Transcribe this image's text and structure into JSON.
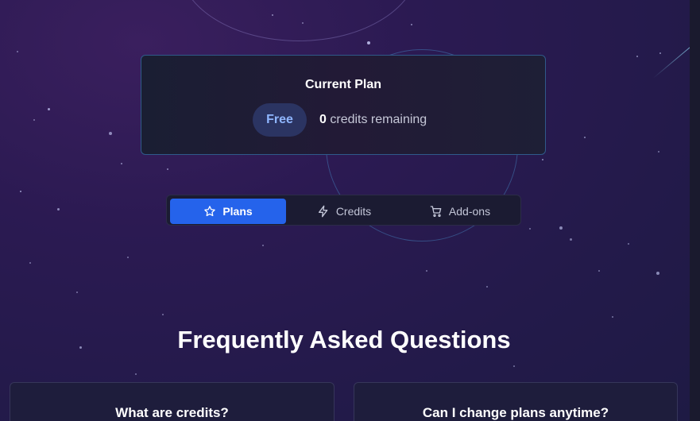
{
  "current_plan": {
    "title": "Current Plan",
    "plan_name": "Free",
    "credits_count": "0",
    "credits_label": "credits remaining"
  },
  "tabs": [
    {
      "label": "Plans",
      "icon": "star-icon",
      "active": true
    },
    {
      "label": "Credits",
      "icon": "lightning-icon",
      "active": false
    },
    {
      "label": "Add-ons",
      "icon": "cart-icon",
      "active": false
    }
  ],
  "faq": {
    "title": "Frequently Asked Questions",
    "questions": [
      {
        "question": "What are credits?"
      },
      {
        "question": "Can I change plans anytime?"
      }
    ]
  },
  "colors": {
    "accent": "#2563eb",
    "badge_text": "#8fb6ff",
    "background": "#2b1a52"
  }
}
